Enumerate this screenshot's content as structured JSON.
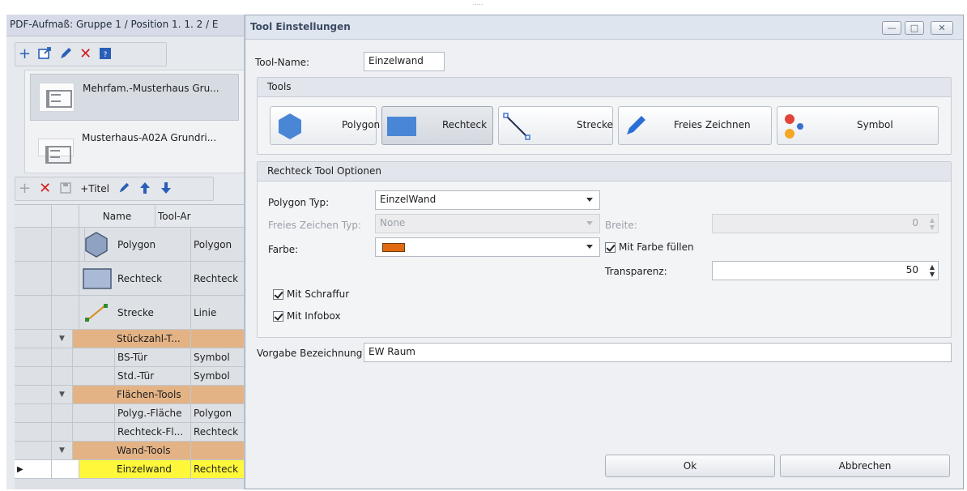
{
  "left_panel": {
    "title": "PDF-Aufmaß: Gruppe 1 / Position 1. 1.   2 / E",
    "toolbar_icons": [
      "add-icon",
      "import-icon",
      "edit-icon",
      "delete-icon",
      "help-icon"
    ],
    "documents": [
      {
        "name": "Mehrfam.-Musterhaus Gru...",
        "selected": true
      },
      {
        "name": "Musterhaus-A02A Grundri...",
        "selected": false
      }
    ],
    "grid_toolbar": {
      "add_title_label": "+Titel"
    },
    "grid": {
      "columns": [
        "Name",
        "Tool-Ar"
      ],
      "rows": [
        {
          "type": "tool",
          "icon": "hexagon-icon",
          "name": "Polygon",
          "tool": "Polygon"
        },
        {
          "type": "tool",
          "icon": "rectangle-icon",
          "name": "Rechteck",
          "tool": "Rechteck"
        },
        {
          "type": "tool",
          "icon": "line-icon",
          "name": "Strecke",
          "tool": "Linie"
        },
        {
          "type": "group",
          "name": "Stückzahl-T...",
          "tool": ""
        },
        {
          "type": "item",
          "name": "BS-Tür",
          "tool": "Symbol"
        },
        {
          "type": "item",
          "name": "Std.-Tür",
          "tool": "Symbol"
        },
        {
          "type": "group",
          "name": "Flächen-Tools",
          "tool": ""
        },
        {
          "type": "item",
          "name": "Polyg.-Fläche",
          "tool": "Polygon"
        },
        {
          "type": "item",
          "name": "Rechteck-Fl...",
          "tool": "Rechteck"
        },
        {
          "type": "group",
          "name": "Wand-Tools",
          "tool": ""
        },
        {
          "type": "selected",
          "name": "Einzelwand",
          "tool": "Rechteck"
        }
      ]
    }
  },
  "dialog": {
    "title": "Tool Einstellungen",
    "window_buttons": {
      "minimize": "—",
      "maximize": "□",
      "close": "✕"
    },
    "tool_name_label": "Tool-Name:",
    "tool_name_value": "Einzelwand",
    "tools_group": {
      "title": "Tools",
      "buttons": [
        {
          "label": "Polygon",
          "icon": "hexagon-icon",
          "active": false
        },
        {
          "label": "Rechteck",
          "icon": "rectangle-icon",
          "active": true
        },
        {
          "label": "Strecke",
          "icon": "line-icon",
          "active": false
        },
        {
          "label": "Freies Zeichnen",
          "icon": "pencil-icon",
          "active": false
        },
        {
          "label": "Symbol",
          "icon": "dots-icon",
          "active": false
        }
      ]
    },
    "options_group": {
      "title": "Rechteck Tool Optionen",
      "polygon_typ_label": "Polygon Typ:",
      "polygon_typ_value": "EinzelWand",
      "freies_typ_label": "Freies Zeichen Typ:",
      "freies_typ_value": "None",
      "breite_label": "Breite:",
      "breite_value": "0",
      "farbe_label": "Farbe:",
      "farbe_color": "#e06a10",
      "mit_farbe_label": "Mit Farbe füllen",
      "transparenz_label": "Transparenz:",
      "transparenz_value": "50",
      "mit_schraffur_label": "Mit Schraffur",
      "mit_infobox_label": "Mit Infobox"
    },
    "vorgabe_label": "Vorgabe Bezeichnung",
    "vorgabe_value": "EW Raum",
    "ok_label": "Ok",
    "cancel_label": "Abbrechen"
  }
}
